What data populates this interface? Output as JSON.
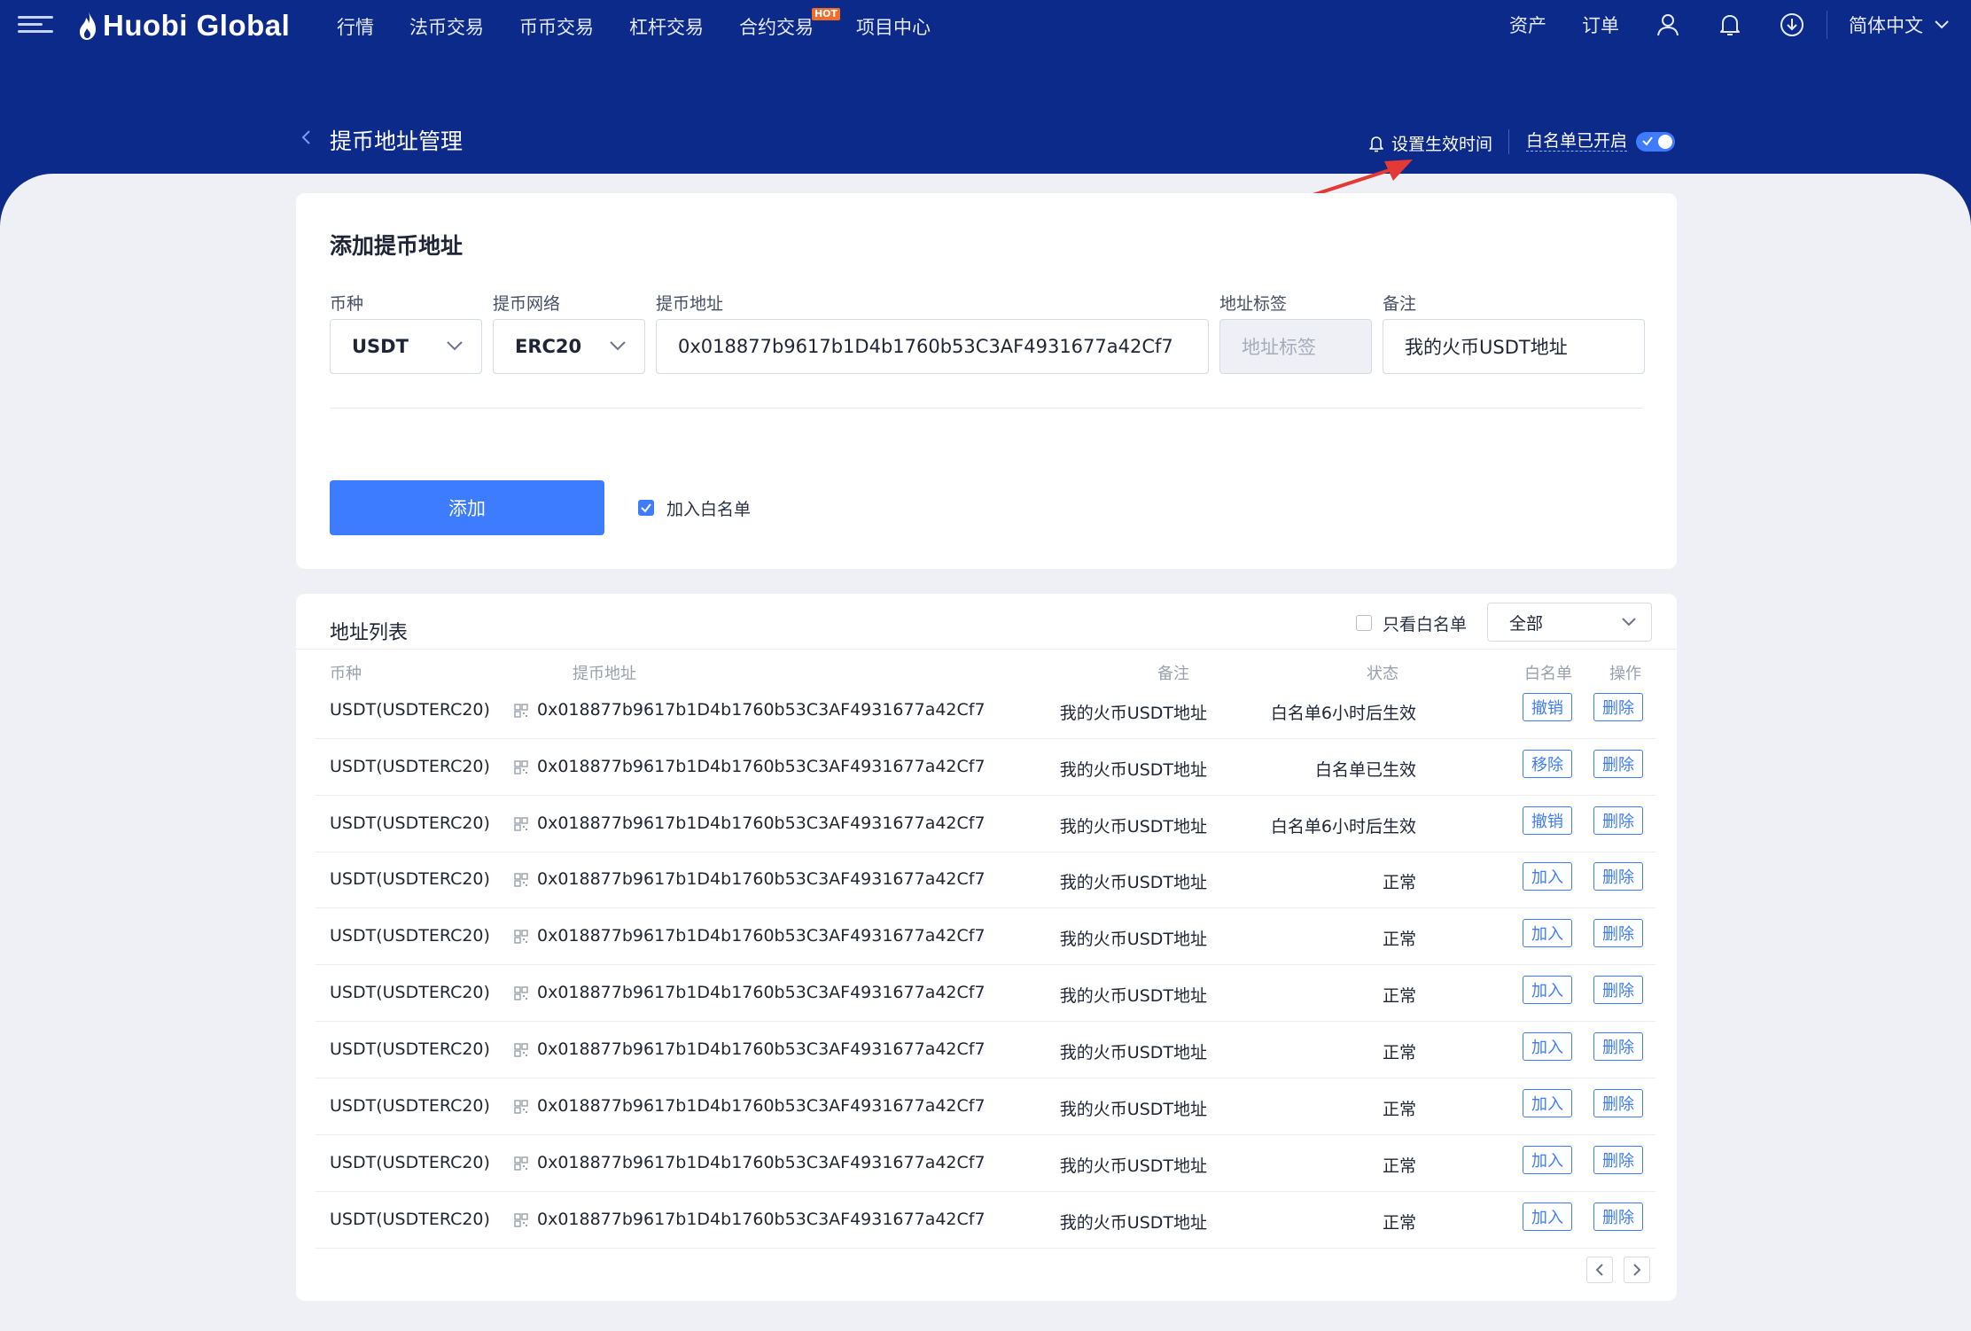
{
  "nav": {
    "logo": "Huobi Global",
    "links": [
      "行情",
      "法币交易",
      "币币交易",
      "杠杆交易",
      "合约交易",
      "项目中心"
    ],
    "hot_badge": "HOT",
    "assets": "资产",
    "orders": "订单",
    "language": "简体中文"
  },
  "header": {
    "title": "提币地址管理",
    "set_time": "设置生效时间",
    "whitelist_status": "白名单已开启"
  },
  "form": {
    "title": "添加提币地址",
    "coin_label": "币种",
    "coin_value": "USDT",
    "network_label": "提币网络",
    "network_value": "ERC20",
    "address_label": "提币地址",
    "address_value": "0x018877b9617b1D4b1760b53C3AF4931677a42Cf7",
    "tag_label": "地址标签",
    "tag_placeholder": "地址标签",
    "note_label": "备注",
    "note_value": "我的火币USDT地址",
    "add_button": "添加",
    "whitelist_checkbox": "加入白名单"
  },
  "list": {
    "title": "地址列表",
    "only_whitelist": "只看白名单",
    "filter_value": "全部",
    "columns": [
      "币种",
      "提币地址",
      "备注",
      "状态",
      "白名单",
      "操作"
    ],
    "rows": [
      {
        "coin": "USDT(USDTERC20)",
        "address": "0x018877b9617b1D4b1760b53C3AF4931677a42Cf7",
        "note": "我的火币USDT地址",
        "status": "白名单6小时后生效",
        "wl_action": "撤销",
        "op": "删除"
      },
      {
        "coin": "USDT(USDTERC20)",
        "address": "0x018877b9617b1D4b1760b53C3AF4931677a42Cf7",
        "note": "我的火币USDT地址",
        "status": "白名单已生效",
        "wl_action": "移除",
        "op": "删除"
      },
      {
        "coin": "USDT(USDTERC20)",
        "address": "0x018877b9617b1D4b1760b53C3AF4931677a42Cf7",
        "note": "我的火币USDT地址",
        "status": "白名单6小时后生效",
        "wl_action": "撤销",
        "op": "删除"
      },
      {
        "coin": "USDT(USDTERC20)",
        "address": "0x018877b9617b1D4b1760b53C3AF4931677a42Cf7",
        "note": "我的火币USDT地址",
        "status": "正常",
        "wl_action": "加入",
        "op": "删除"
      },
      {
        "coin": "USDT(USDTERC20)",
        "address": "0x018877b9617b1D4b1760b53C3AF4931677a42Cf7",
        "note": "我的火币USDT地址",
        "status": "正常",
        "wl_action": "加入",
        "op": "删除"
      },
      {
        "coin": "USDT(USDTERC20)",
        "address": "0x018877b9617b1D4b1760b53C3AF4931677a42Cf7",
        "note": "我的火币USDT地址",
        "status": "正常",
        "wl_action": "加入",
        "op": "删除"
      },
      {
        "coin": "USDT(USDTERC20)",
        "address": "0x018877b9617b1D4b1760b53C3AF4931677a42Cf7",
        "note": "我的火币USDT地址",
        "status": "正常",
        "wl_action": "加入",
        "op": "删除"
      },
      {
        "coin": "USDT(USDTERC20)",
        "address": "0x018877b9617b1D4b1760b53C3AF4931677a42Cf7",
        "note": "我的火币USDT地址",
        "status": "正常",
        "wl_action": "加入",
        "op": "删除"
      },
      {
        "coin": "USDT(USDTERC20)",
        "address": "0x018877b9617b1D4b1760b53C3AF4931677a42Cf7",
        "note": "我的火币USDT地址",
        "status": "正常",
        "wl_action": "加入",
        "op": "删除"
      },
      {
        "coin": "USDT(USDTERC20)",
        "address": "0x018877b9617b1D4b1760b53C3AF4931677a42Cf7",
        "note": "我的火币USDT地址",
        "status": "正常",
        "wl_action": "加入",
        "op": "删除"
      }
    ]
  },
  "colors": {
    "brand_navy": "#0c2a8a",
    "accent_blue": "#3d7bff",
    "annotation_red": "#e53935"
  }
}
